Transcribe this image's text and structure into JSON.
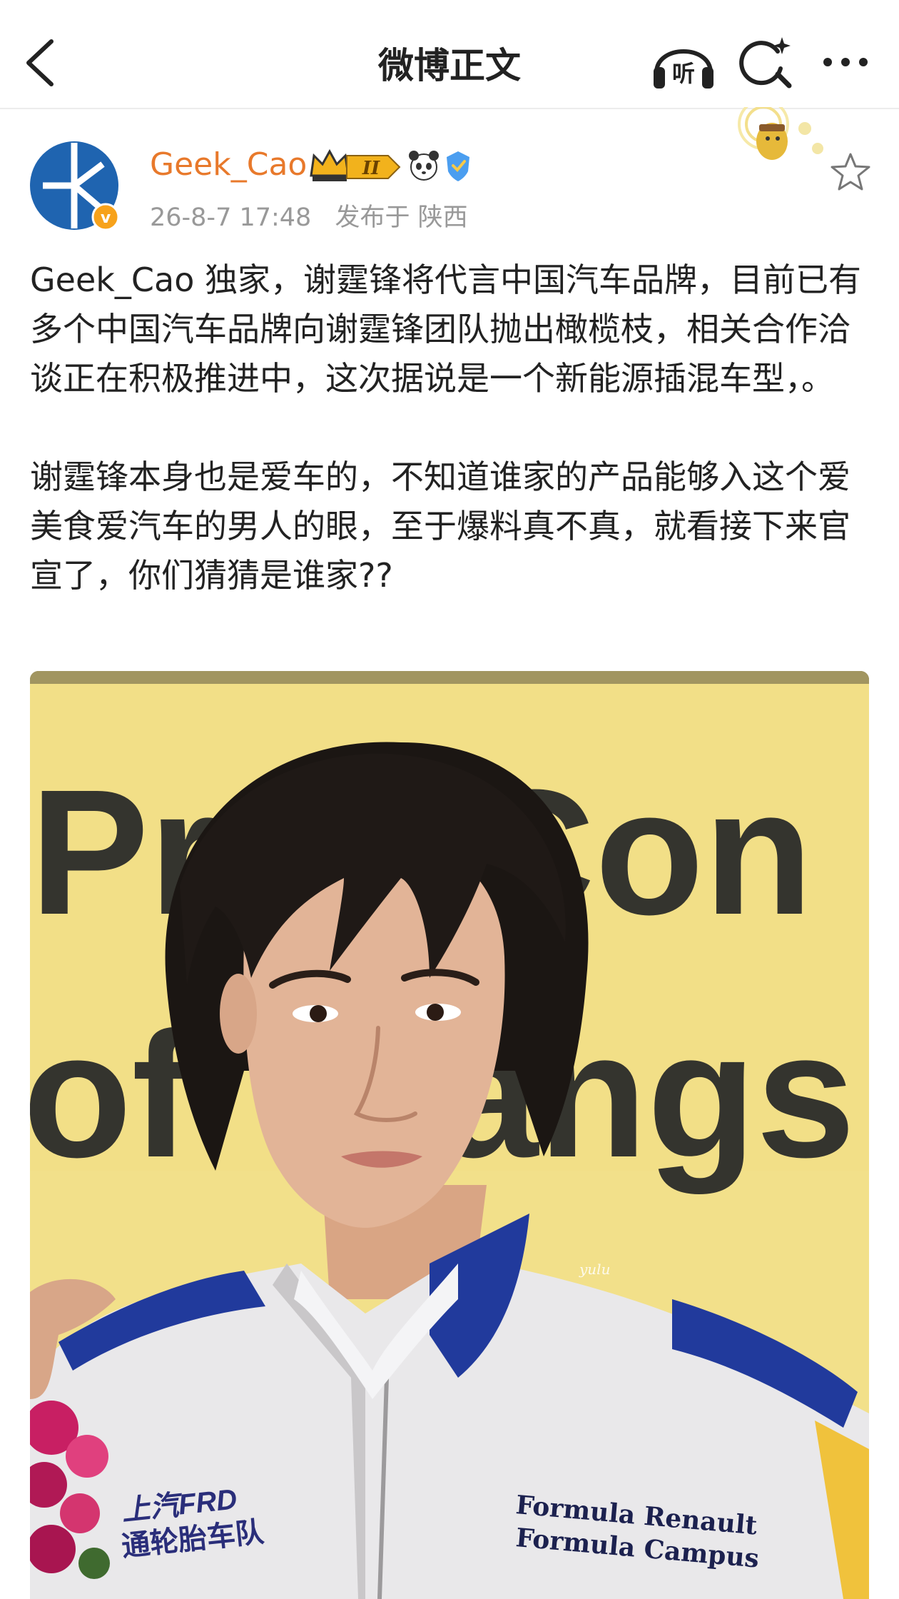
{
  "nav": {
    "title": "微博正文",
    "back_icon": "chevron-left-icon",
    "listen_icon": "headphones-icon",
    "listen_label": "听",
    "search_icon": "search-sparkle-icon",
    "more_icon": "more-dots-icon"
  },
  "author": {
    "name": "Geek_Cao",
    "badge_label": "II",
    "timestamp": "26-8-7 17:48",
    "location": "发布于 陕西",
    "name_color": "#e8792b"
  },
  "post": {
    "paragraph1": "Geek_Cao 独家，谢霆锋将代言中国汽车品牌，目前已有多个中国汽车品牌向谢霆锋团队抛出橄榄枝，相关合作洽谈正在积极推进中，这次据说是一个新能源插混车型，。",
    "paragraph2": "谢霆锋本身也是爱车的，不知道谁家的产品能够入这个爱美食爱汽车的男人的眼，至于爆料真不真，就看接下来官宣了，你们猜猜是谁家??"
  },
  "photo": {
    "backdrop_text_top": "Pr     Con",
    "backdrop_text_bottom": "of     angs",
    "jacket_text_line1": "Formula Renault",
    "jacket_text_line2": "Formula Campus",
    "patch_text_line1": "上汽FRD",
    "patch_text_line2": "通轮胎车队",
    "watermark": "yulu"
  }
}
